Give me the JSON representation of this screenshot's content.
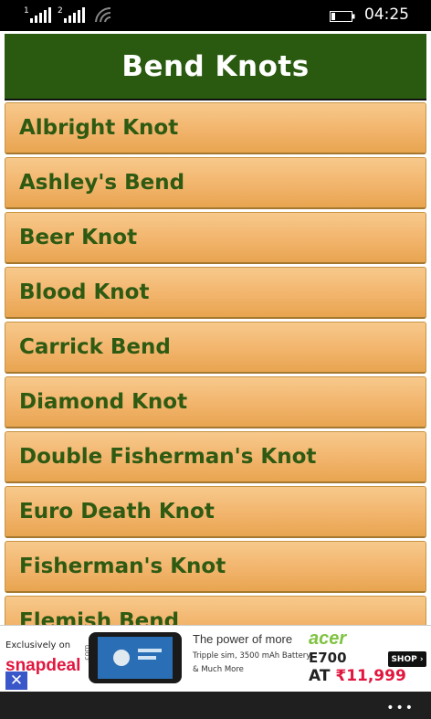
{
  "status": {
    "sim1": "1",
    "sim2": "2",
    "time": "04:25"
  },
  "page": {
    "title": "Bend Knots",
    "items": [
      "Albright Knot",
      "Ashley's Bend",
      "Beer Knot",
      "Blood Knot",
      "Carrick Bend",
      "Diamond Knot",
      "Double Fisherman's Knot",
      "Euro Death Knot",
      "Fisherman's Knot",
      "Flemish Bend"
    ]
  },
  "ad": {
    "exclusively": "Exclusively on",
    "store": "snapdeal",
    "store_suffix": ".com",
    "tagline": "The power of more",
    "spec_line1": "Tripple sim, 3500 mAh Battery",
    "spec_line2": "& Much More",
    "brand": "acer",
    "model": "E700",
    "price_prefix": "AT ",
    "price": "₹11,999",
    "shop": "SHOP ›",
    "close": "✕"
  },
  "appbar": {
    "more": "•••"
  },
  "colors": {
    "header_bg": "#2a5a10",
    "item_text": "#2e5a12",
    "item_bg": "#f2b46c"
  },
  "icons": [
    "signal-icon",
    "wifi-icon",
    "battery-icon",
    "close-icon",
    "more-icon"
  ]
}
